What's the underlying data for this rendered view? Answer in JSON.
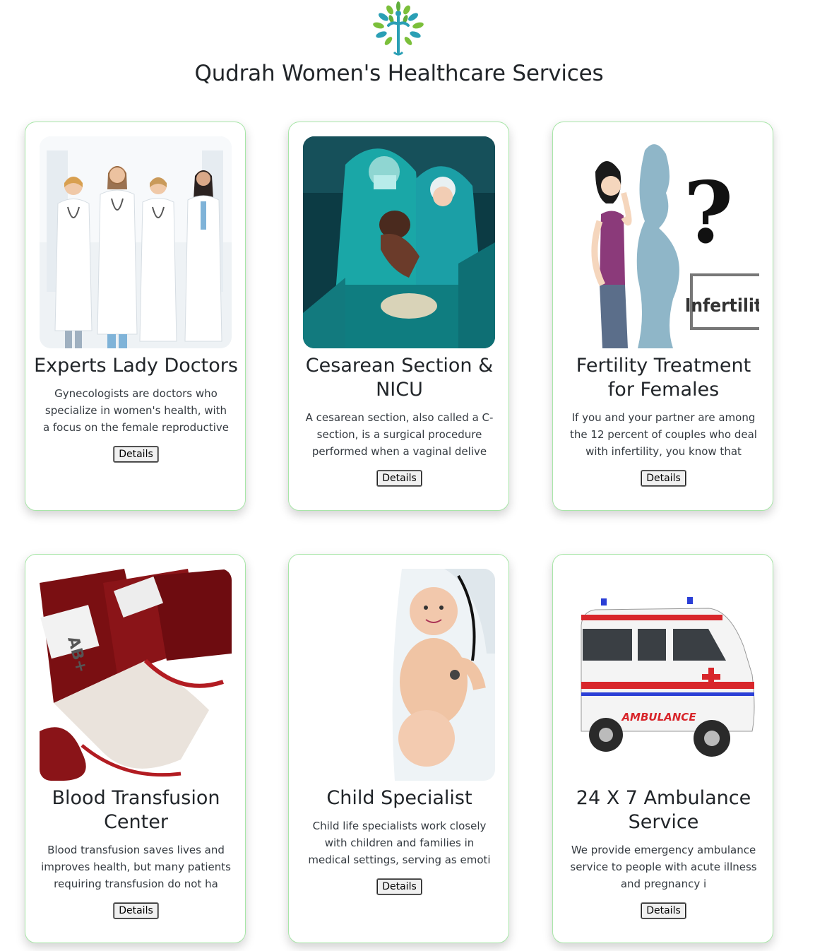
{
  "header": {
    "title": "Qudrah Women's Healthcare Services"
  },
  "cards": [
    {
      "title": "Experts Lady Doctors",
      "text": "Gynecologists are doctors who specialize in women's health, with a focus on the female reproductive",
      "button": "Details"
    },
    {
      "title": "Cesarean Section & NICU",
      "text": "A cesarean section, also called a C-section, is a surgical procedure performed when a vaginal delive",
      "button": "Details"
    },
    {
      "title": "Fertility Treatment for Females",
      "text": "If you and your partner are among the 12 percent of couples who deal with infertility, you know that",
      "button": "Details",
      "image_label": "Infertility"
    },
    {
      "title": "Blood Transfusion Center",
      "text": "Blood transfusion saves lives and improves health, but many patients requiring transfusion do not ha",
      "button": "Details",
      "image_label": "AB+"
    },
    {
      "title": "Child Specialist",
      "text": "Child life specialists work closely with children and families in medical settings, serving as emoti",
      "button": "Details"
    },
    {
      "title": "24 X 7 Ambulance Service",
      "text": "We provide emergency ambulance service to people with acute illness and pregnancy i",
      "button": "Details",
      "image_label": "AMBULANCE"
    }
  ],
  "colors": {
    "card_border": "#a8e6a8",
    "title_text": "#212529",
    "logo_teal": "#2a9fb5",
    "logo_green": "#7bbf3a"
  }
}
